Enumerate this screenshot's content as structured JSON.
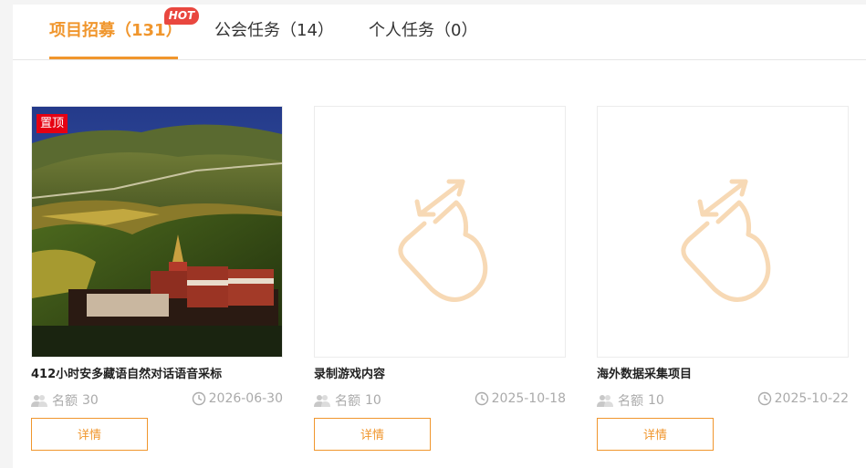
{
  "tabs": [
    {
      "label": "项目招募（131）",
      "active": true
    },
    {
      "label": "公会任务（14）",
      "active": false
    },
    {
      "label": "个人任务（0）",
      "active": false
    }
  ],
  "hot_badge": "HOT",
  "cards": [
    {
      "title": "412小时安多藏语自然对话语音采标",
      "pinned": true,
      "pin_label": "置顶",
      "quota_label": "名额",
      "quota": "30",
      "date": "2026-06-30",
      "button": "详情",
      "image": "landscape-photo"
    },
    {
      "title": "录制游戏内容",
      "pinned": false,
      "quota_label": "名额",
      "quota": "10",
      "date": "2025-10-18",
      "button": "详情",
      "image": "placeholder-hand-icon"
    },
    {
      "title": "海外数据采集项目",
      "pinned": false,
      "quota_label": "名额",
      "quota": "10",
      "date": "2025-10-22",
      "button": "详情",
      "image": "placeholder-hand-icon"
    }
  ],
  "colors": {
    "accent": "#f0962d",
    "hot": "#e9473f",
    "pin": "#e60012",
    "placeholder_icon": "#f7d9b5"
  }
}
